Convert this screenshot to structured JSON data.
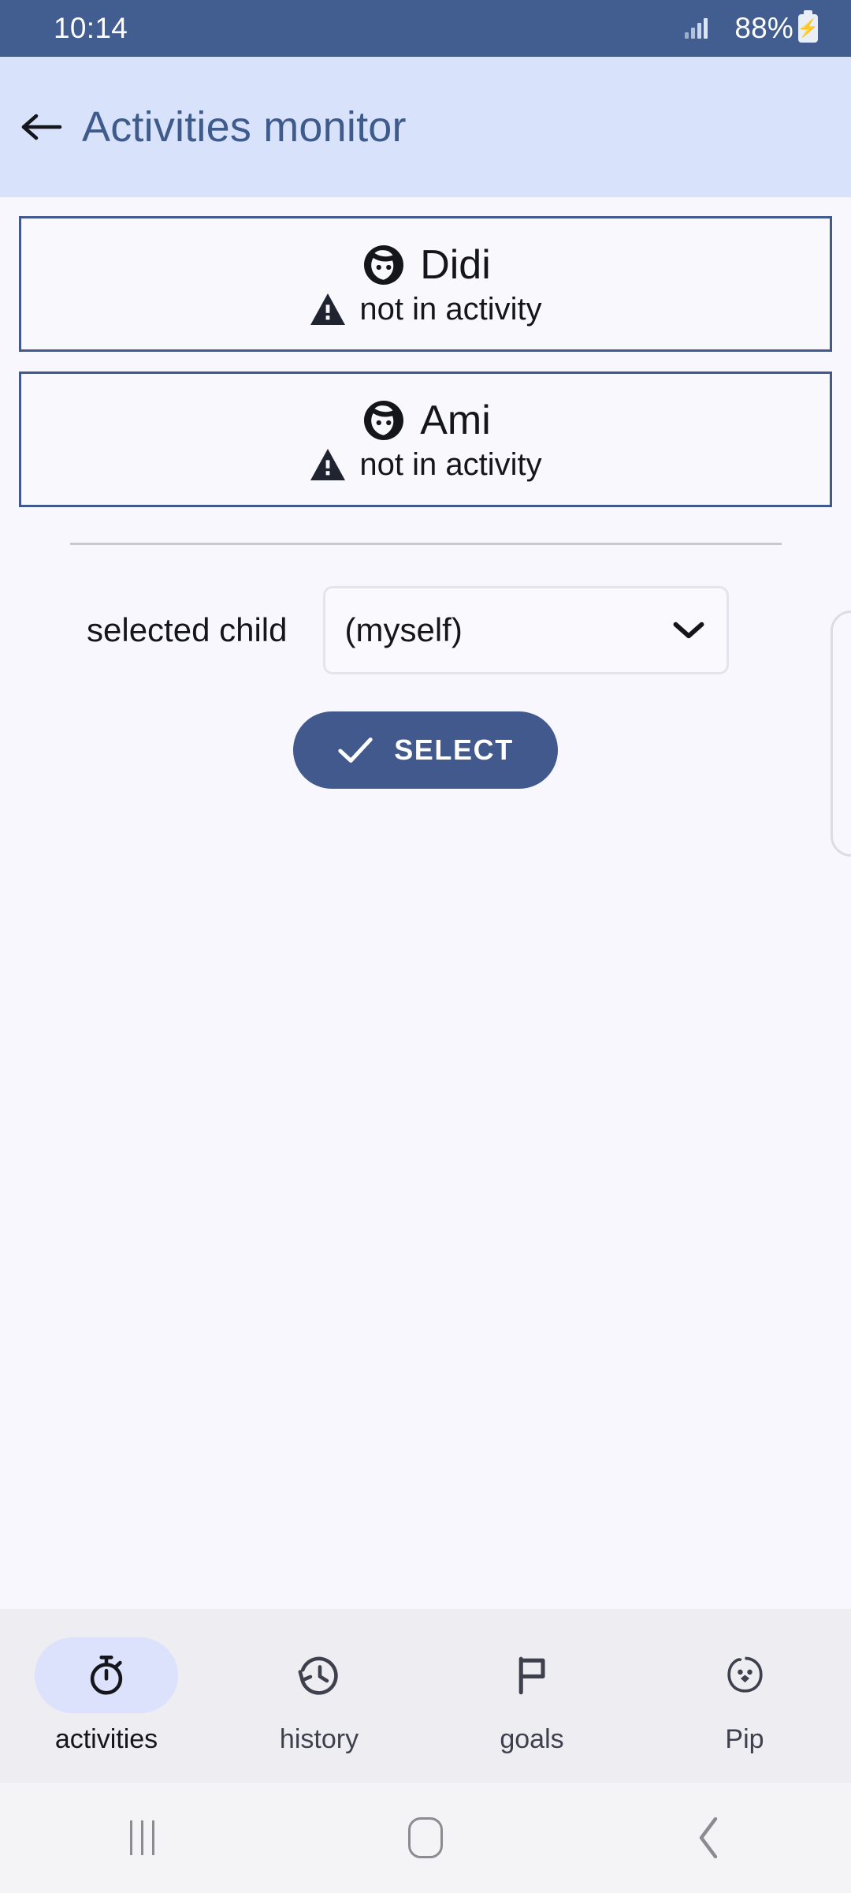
{
  "status_bar": {
    "clock": "10:14",
    "battery_percent": "88%",
    "signal_icon": "signal-bars-icon",
    "battery_icon": "battery-charging-icon"
  },
  "header": {
    "back_icon": "back-arrow-icon",
    "title": "Activities monitor",
    "background": "#d9e2fb",
    "title_color": "#3f5b8b"
  },
  "children": [
    {
      "avatar_icon": "child-face-icon",
      "name": "Didi",
      "status_icon": "warning-triangle-icon",
      "status": "not in activity"
    },
    {
      "avatar_icon": "child-face-icon",
      "name": "Ami",
      "status_icon": "warning-triangle-icon",
      "status": "not in activity"
    }
  ],
  "selector": {
    "label": "selected child",
    "value": "(myself)",
    "chevron_icon": "chevron-down-icon",
    "button_label": "SELECT",
    "button_icon": "check-icon",
    "button_color": "#41598c"
  },
  "tabs": [
    {
      "label": "activities",
      "icon": "stopwatch-icon",
      "active": true
    },
    {
      "label": "history",
      "icon": "history-clock-icon",
      "active": false
    },
    {
      "label": "goals",
      "icon": "flag-icon",
      "active": false
    },
    {
      "label": "Pip",
      "icon": "pip-bird-face-icon",
      "active": false
    }
  ],
  "system_nav": {
    "recents_icon": "recents-icon",
    "home_icon": "home-icon",
    "back_icon": "system-back-icon"
  }
}
